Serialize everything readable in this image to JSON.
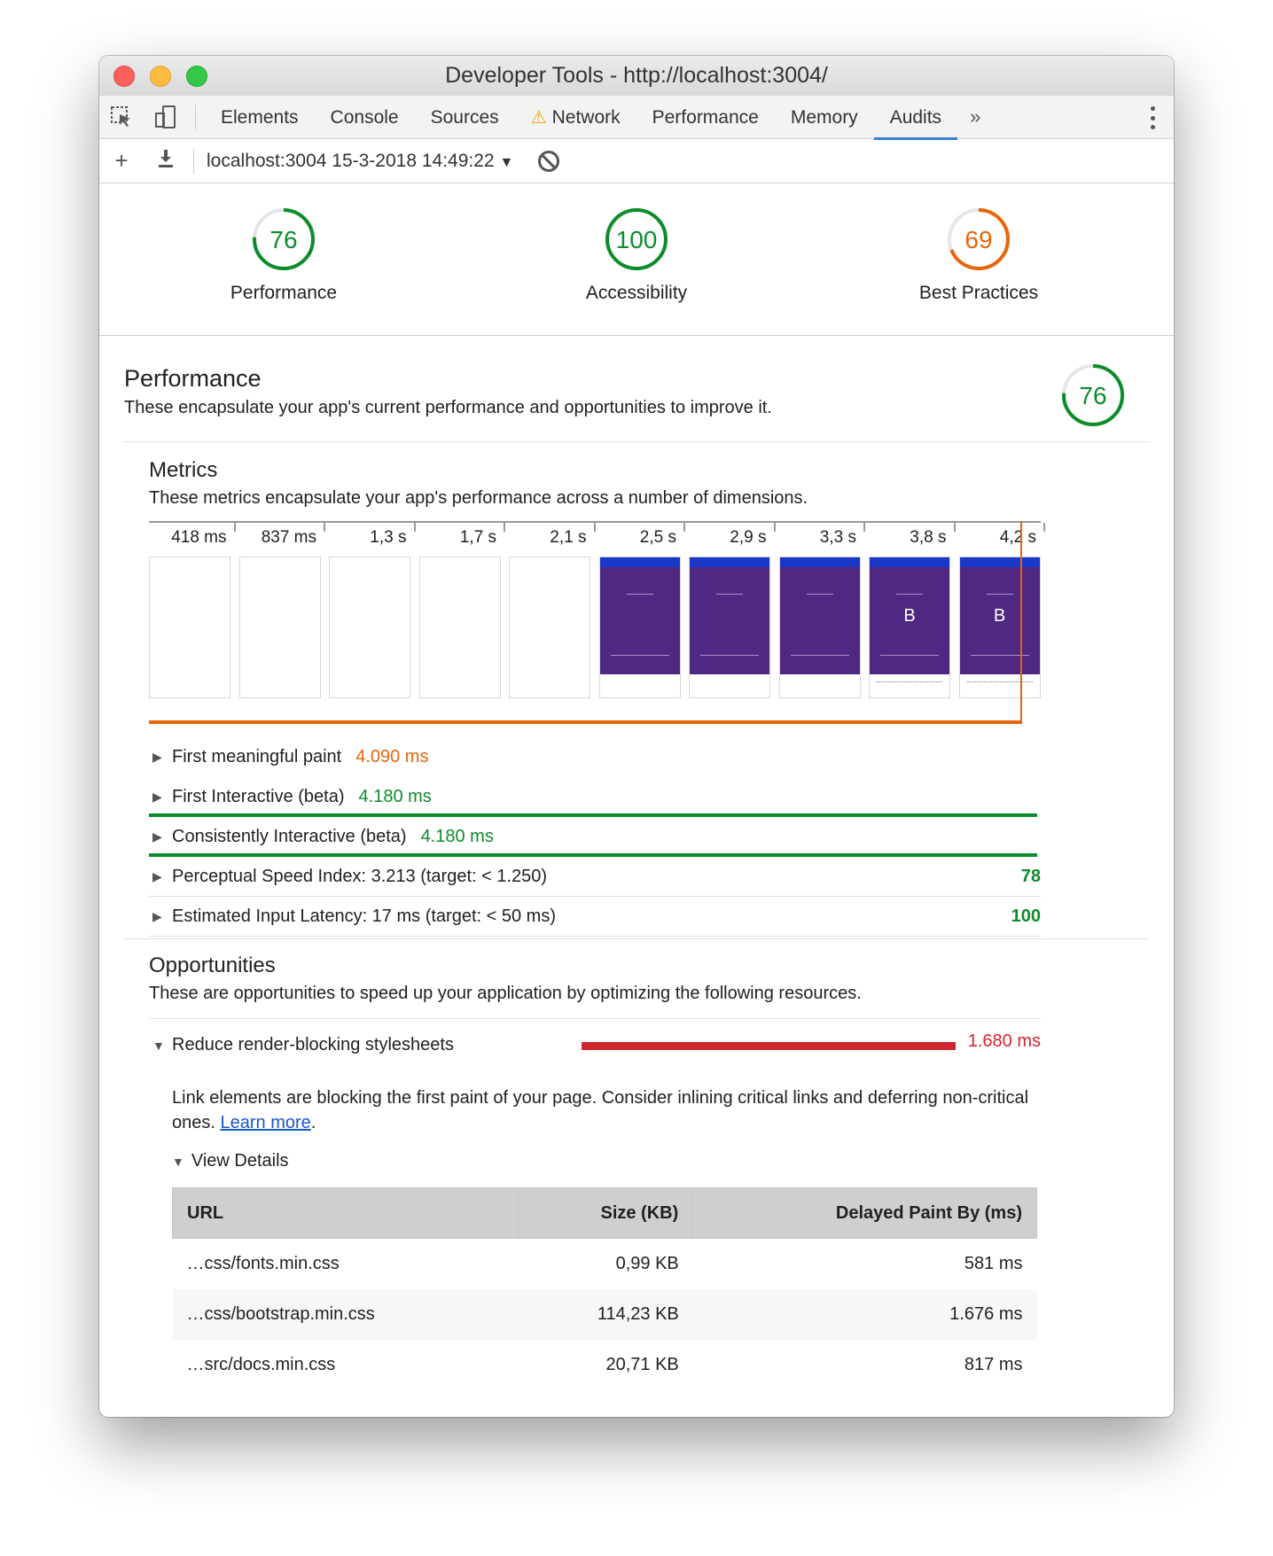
{
  "window": {
    "title": "Developer Tools - http://localhost:3004/"
  },
  "tabs": [
    {
      "label": "Elements"
    },
    {
      "label": "Console"
    },
    {
      "label": "Sources"
    },
    {
      "label": "Network",
      "warning": true
    },
    {
      "label": "Performance"
    },
    {
      "label": "Memory"
    },
    {
      "label": "Audits",
      "active": true
    }
  ],
  "tabs_overflow": "»",
  "report_bar": {
    "selected_report": "localhost:3004 15-3-2018 14:49:22"
  },
  "scores": [
    {
      "value": "76",
      "label": "Performance",
      "fraction": 0.76,
      "color": "#0c8c2a"
    },
    {
      "value": "100",
      "label": "Accessibility",
      "fraction": 1.0,
      "color": "#0c8c2a"
    },
    {
      "value": "69",
      "label": "Best Practices",
      "fraction": 0.69,
      "color": "#e8650a"
    }
  ],
  "performance": {
    "title": "Performance",
    "description": "These encapsulate your app's current performance and opportunities to improve it.",
    "score": "76",
    "score_fraction": 0.76
  },
  "metrics": {
    "title": "Metrics",
    "description": "These metrics encapsulate your app's performance across a number of dimensions.",
    "timeline_ticks": [
      "418 ms",
      "837 ms",
      "1,3 s",
      "1,7 s",
      "2,1 s",
      "2,5 s",
      "2,9 s",
      "3,3 s",
      "3,8 s",
      "4,2 s"
    ],
    "rows": [
      {
        "label": "First meaningful paint",
        "value": "4.090 ms",
        "status": "orange"
      },
      {
        "label": "First Interactive (beta)",
        "value": "4.180 ms",
        "status": "green"
      },
      {
        "label": "Consistently Interactive (beta)",
        "value": "4.180 ms",
        "status": "green"
      },
      {
        "label": "Perceptual Speed Index: 3.213 (target: < 1.250)",
        "score": "78"
      },
      {
        "label": "Estimated Input Latency: 17 ms (target: < 50 ms)",
        "score": "100"
      }
    ]
  },
  "opportunities": {
    "title": "Opportunities",
    "description": "These are opportunities to speed up your application by optimizing the following resources.",
    "item": {
      "label": "Reduce render-blocking stylesheets",
      "value": "1.680 ms",
      "description": "Link elements are blocking the first paint of your page. Consider inlining critical links and deferring non-critical ones.",
      "learn_more": "Learn more",
      "view_details": "View Details"
    },
    "table": {
      "headers": [
        "URL",
        "Size (KB)",
        "Delayed Paint By (ms)"
      ],
      "rows": [
        [
          "…css/fonts.min.css",
          "0,99 KB",
          "581 ms"
        ],
        [
          "…css/bootstrap.min.css",
          "114,23 KB",
          "1.676 ms"
        ],
        [
          "…src/docs.min.css",
          "20,71 KB",
          "817 ms"
        ]
      ]
    }
  }
}
